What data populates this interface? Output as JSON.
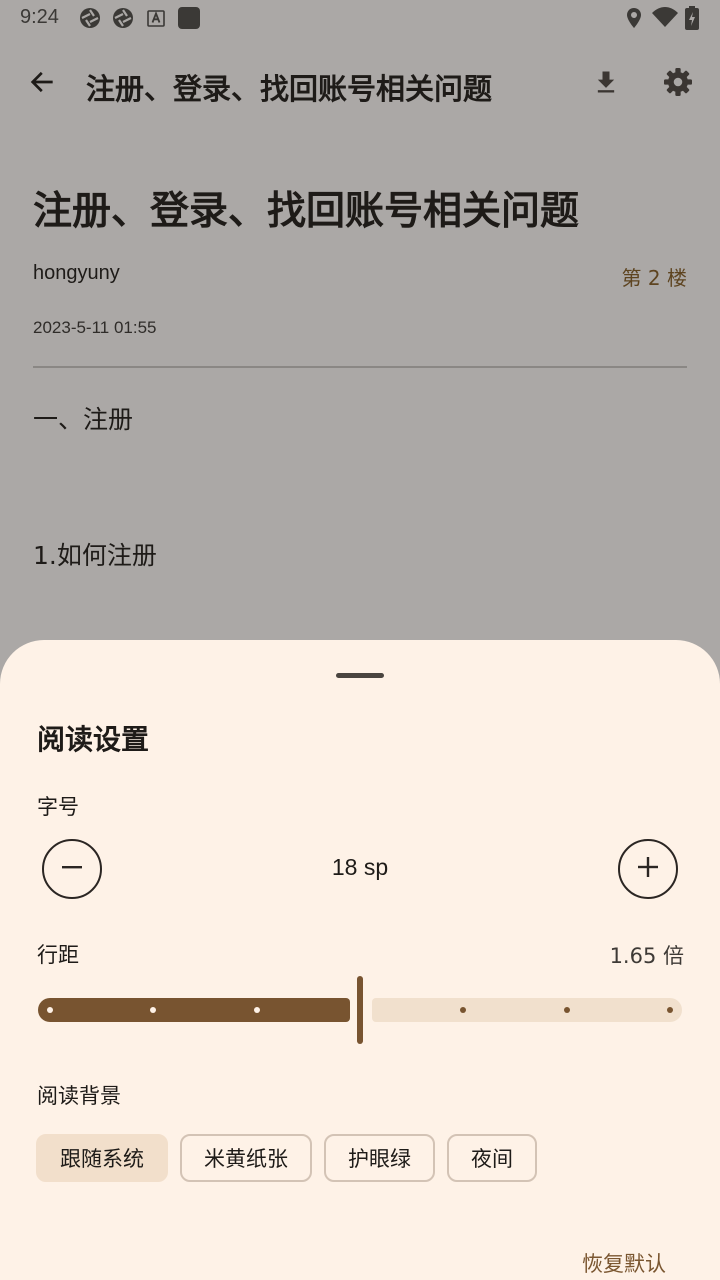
{
  "status_bar": {
    "time": "9:24",
    "left_icons": [
      "aperture-icon",
      "aperture-icon",
      "font-a-icon",
      "square-app-icon"
    ],
    "right_icons": [
      "location-icon",
      "wifi-icon",
      "battery-charging-icon"
    ]
  },
  "app_bar": {
    "title": "注册、登录、找回账号相关问题",
    "back_icon": "arrow-left-icon",
    "download_icon": "download-icon",
    "settings_icon": "gear-icon"
  },
  "article": {
    "title": "注册、登录、找回账号相关问题",
    "author": "hongyuny",
    "floor": "第 2 楼",
    "date": "2023-5-11 01:55",
    "paragraphs": [
      "一、注册",
      "1.如何注册"
    ]
  },
  "reading_settings": {
    "title": "阅读设置",
    "font_size": {
      "label": "字号",
      "value": "18 sp",
      "decrease_icon": "minus-icon",
      "increase_icon": "plus-icon"
    },
    "line_spacing": {
      "label": "行距",
      "value": "1.65 倍",
      "steps": 7,
      "selected_step": 3
    },
    "background": {
      "label": "阅读背景",
      "options": [
        "跟随系统",
        "米黄纸张",
        "护眼绿",
        "夜间"
      ],
      "selected": "跟随系统"
    },
    "restore_label": "恢复默认"
  },
  "colors": {
    "accent": "#785430",
    "sheet_bg": "#fef2e7",
    "scrim_bg": "#aba8a6",
    "track_inactive": "#f1e0cd",
    "chip_selected": "#f2dfcb"
  }
}
